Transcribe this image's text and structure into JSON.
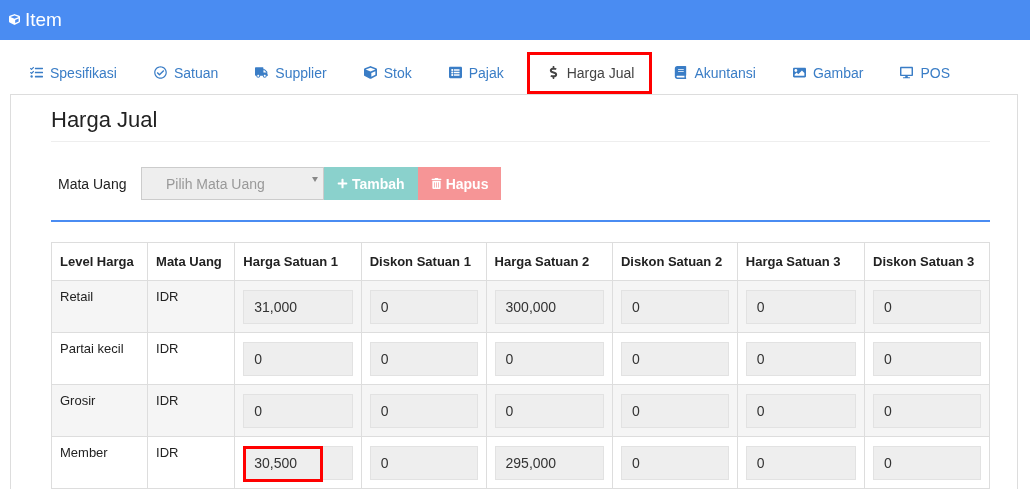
{
  "header": {
    "title": "Item"
  },
  "tabs": [
    {
      "label": "Spesifikasi",
      "selected": false,
      "highlighted": false
    },
    {
      "label": "Satuan",
      "selected": false,
      "highlighted": false
    },
    {
      "label": "Supplier",
      "selected": false,
      "highlighted": false
    },
    {
      "label": "Stok",
      "selected": false,
      "highlighted": false
    },
    {
      "label": "Pajak",
      "selected": false,
      "highlighted": false
    },
    {
      "label": "Harga Jual",
      "selected": true,
      "highlighted": true
    },
    {
      "label": "Akuntansi",
      "selected": false,
      "highlighted": false
    },
    {
      "label": "Gambar",
      "selected": false,
      "highlighted": false
    },
    {
      "label": "POS",
      "selected": false,
      "highlighted": false
    }
  ],
  "section_title": "Harga Jual",
  "currency_form": {
    "label": "Mata Uang",
    "select": {
      "placeholder": "Pilih Mata Uang"
    },
    "add_button": "Tambah",
    "delete_button": "Hapus"
  },
  "table": {
    "columns": [
      "Level Harga",
      "Mata Uang",
      "Harga Satuan 1",
      "Diskon Satuan 1",
      "Harga Satuan 2",
      "Diskon Satuan 2",
      "Harga Satuan 3",
      "Diskon Satuan 3"
    ],
    "rows": [
      [
        {
          "kind": "text",
          "value": "Retail",
          "highlighted": false
        },
        {
          "kind": "text",
          "value": "IDR",
          "highlighted": false
        },
        {
          "kind": "input",
          "value": "31,000",
          "highlighted": false
        },
        {
          "kind": "input",
          "value": "0",
          "highlighted": false
        },
        {
          "kind": "input",
          "value": "300,000",
          "highlighted": false
        },
        {
          "kind": "input",
          "value": "0",
          "highlighted": false
        },
        {
          "kind": "input",
          "value": "0",
          "highlighted": false
        },
        {
          "kind": "input",
          "value": "0",
          "highlighted": false
        }
      ],
      [
        {
          "kind": "text",
          "value": "Partai kecil",
          "highlighted": false
        },
        {
          "kind": "text",
          "value": "IDR",
          "highlighted": false
        },
        {
          "kind": "input",
          "value": "0",
          "highlighted": false
        },
        {
          "kind": "input",
          "value": "0",
          "highlighted": false
        },
        {
          "kind": "input",
          "value": "0",
          "highlighted": false
        },
        {
          "kind": "input",
          "value": "0",
          "highlighted": false
        },
        {
          "kind": "input",
          "value": "0",
          "highlighted": false
        },
        {
          "kind": "input",
          "value": "0",
          "highlighted": false
        }
      ],
      [
        {
          "kind": "text",
          "value": "Grosir",
          "highlighted": false
        },
        {
          "kind": "text",
          "value": "IDR",
          "highlighted": false
        },
        {
          "kind": "input",
          "value": "0",
          "highlighted": false
        },
        {
          "kind": "input",
          "value": "0",
          "highlighted": false
        },
        {
          "kind": "input",
          "value": "0",
          "highlighted": false
        },
        {
          "kind": "input",
          "value": "0",
          "highlighted": false
        },
        {
          "kind": "input",
          "value": "0",
          "highlighted": false
        },
        {
          "kind": "input",
          "value": "0",
          "highlighted": false
        }
      ],
      [
        {
          "kind": "text",
          "value": "Member",
          "highlighted": false
        },
        {
          "kind": "text",
          "value": "IDR",
          "highlighted": false
        },
        {
          "kind": "input",
          "value": "30,500",
          "highlighted": true
        },
        {
          "kind": "input",
          "value": "0",
          "highlighted": false
        },
        {
          "kind": "input",
          "value": "295,000",
          "highlighted": false
        },
        {
          "kind": "input",
          "value": "0",
          "highlighted": false
        },
        {
          "kind": "input",
          "value": "0",
          "highlighted": false
        },
        {
          "kind": "input",
          "value": "0",
          "highlighted": false
        }
      ]
    ]
  }
}
